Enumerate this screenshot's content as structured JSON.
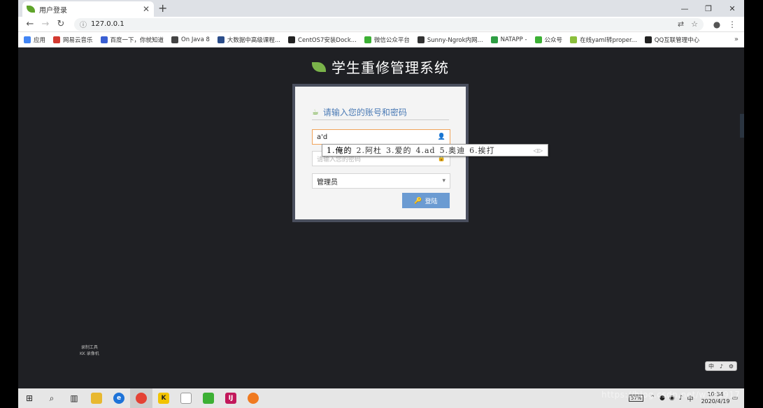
{
  "tab": {
    "title": "用户登录",
    "close": "✕",
    "new_tab": "+"
  },
  "window_controls": {
    "minimize": "—",
    "restore": "❐",
    "close": "✕"
  },
  "address": {
    "back": "←",
    "forward": "→",
    "reload": "↻",
    "info": "ⓘ",
    "url": "127.0.0.1",
    "translate": "⇄",
    "star": "☆",
    "profile": "●",
    "menu": "⋮"
  },
  "bookmarks": [
    {
      "label": "应用",
      "color": "#4285f4"
    },
    {
      "label": "网易云音乐",
      "color": "#d33a31"
    },
    {
      "label": "百度一下，你就知道",
      "color": "#3a5fd3"
    },
    {
      "label": "On Java 8",
      "color": "#444444"
    },
    {
      "label": "大数据中高级课程...",
      "color": "#2b4d8a"
    },
    {
      "label": "CentOS7安装Dock...",
      "color": "#222222"
    },
    {
      "label": "微信公众平台",
      "color": "#3cb034"
    },
    {
      "label": "Sunny-Ngrok内网...",
      "color": "#333333"
    },
    {
      "label": "NATAPP -",
      "color": "#2f9e44"
    },
    {
      "label": "公众号",
      "color": "#3cb034"
    },
    {
      "label": "在线yaml转proper...",
      "color": "#8bbf3c"
    },
    {
      "label": "QQ互联管理中心",
      "color": "#222222"
    }
  ],
  "bookmarks_more": "»",
  "page": {
    "system_title": "学生重修管理系统",
    "prompt": "请输入您的账号和密码",
    "username_value": "a'd",
    "password_placeholder": "请输入您的密码",
    "role_selected": "管理员",
    "login_label": "登陆"
  },
  "ime": {
    "candidates": [
      "1.俺的",
      "2.阿杜",
      "3.爱的",
      "4.ad",
      "5.奥迪",
      "6.挨打"
    ],
    "arrows": "◁▷"
  },
  "recorder": {
    "line1": "录制工具",
    "line2": "KK 录像机"
  },
  "imebar": [
    "中",
    "♪",
    "⚙"
  ],
  "taskbar": {
    "battery": "57%",
    "time": "10:34",
    "date": "2020/4/19"
  },
  "watermark": "https://blog.csdn.net/w745917"
}
